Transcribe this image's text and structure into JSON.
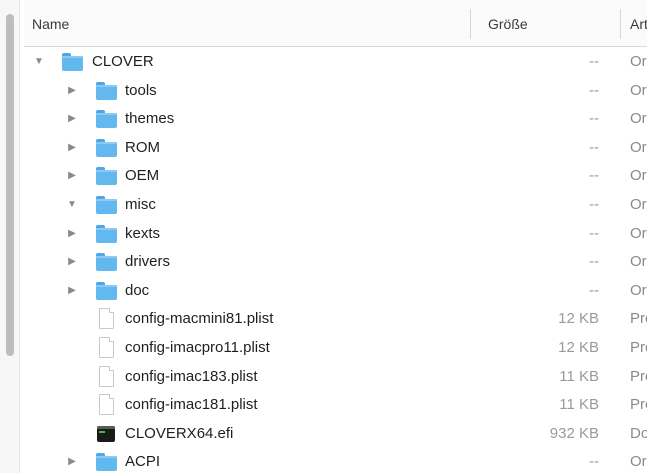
{
  "header": {
    "name_label": "Name",
    "size_label": "Größe",
    "kind_label": "Art"
  },
  "rows": [
    {
      "name": "CLOVER",
      "size": "--",
      "kind": "Ordner",
      "type": "folder",
      "expanded": true,
      "level": 0
    },
    {
      "name": "tools",
      "size": "--",
      "kind": "Ordner",
      "type": "folder",
      "expanded": false,
      "level": 1
    },
    {
      "name": "themes",
      "size": "--",
      "kind": "Ordner",
      "type": "folder",
      "expanded": false,
      "level": 1
    },
    {
      "name": "ROM",
      "size": "--",
      "kind": "Ordner",
      "type": "folder",
      "expanded": false,
      "level": 1
    },
    {
      "name": "OEM",
      "size": "--",
      "kind": "Ordner",
      "type": "folder",
      "expanded": false,
      "level": 1
    },
    {
      "name": "misc",
      "size": "--",
      "kind": "Ordner",
      "type": "folder",
      "expanded": true,
      "level": 1
    },
    {
      "name": "kexts",
      "size": "--",
      "kind": "Ordner",
      "type": "folder",
      "expanded": false,
      "level": 1
    },
    {
      "name": "drivers",
      "size": "--",
      "kind": "Ordner",
      "type": "folder",
      "expanded": false,
      "level": 1
    },
    {
      "name": "doc",
      "size": "--",
      "kind": "Ordner",
      "type": "folder",
      "expanded": false,
      "level": 1
    },
    {
      "name": "config-macmini81.plist",
      "size": "12 KB",
      "kind": "Property List",
      "type": "file",
      "level": 1
    },
    {
      "name": "config-imacpro11.plist",
      "size": "12 KB",
      "kind": "Property List",
      "type": "file",
      "level": 1
    },
    {
      "name": "config-imac183.plist",
      "size": "11 KB",
      "kind": "Property List",
      "type": "file",
      "level": 1
    },
    {
      "name": "config-imac181.plist",
      "size": "11 KB",
      "kind": "Property List",
      "type": "file",
      "level": 1
    },
    {
      "name": "CLOVERX64.efi",
      "size": "932 KB",
      "kind": "Dokument",
      "type": "exec",
      "level": 1
    },
    {
      "name": "ACPI",
      "size": "--",
      "kind": "Ordner",
      "type": "folder",
      "expanded": false,
      "level": 1
    }
  ],
  "icons": {
    "folder": "folder-icon",
    "file": "document-icon",
    "exec": "executable-icon",
    "expanded": "disclosure-down-icon",
    "collapsed": "disclosure-right-icon"
  }
}
